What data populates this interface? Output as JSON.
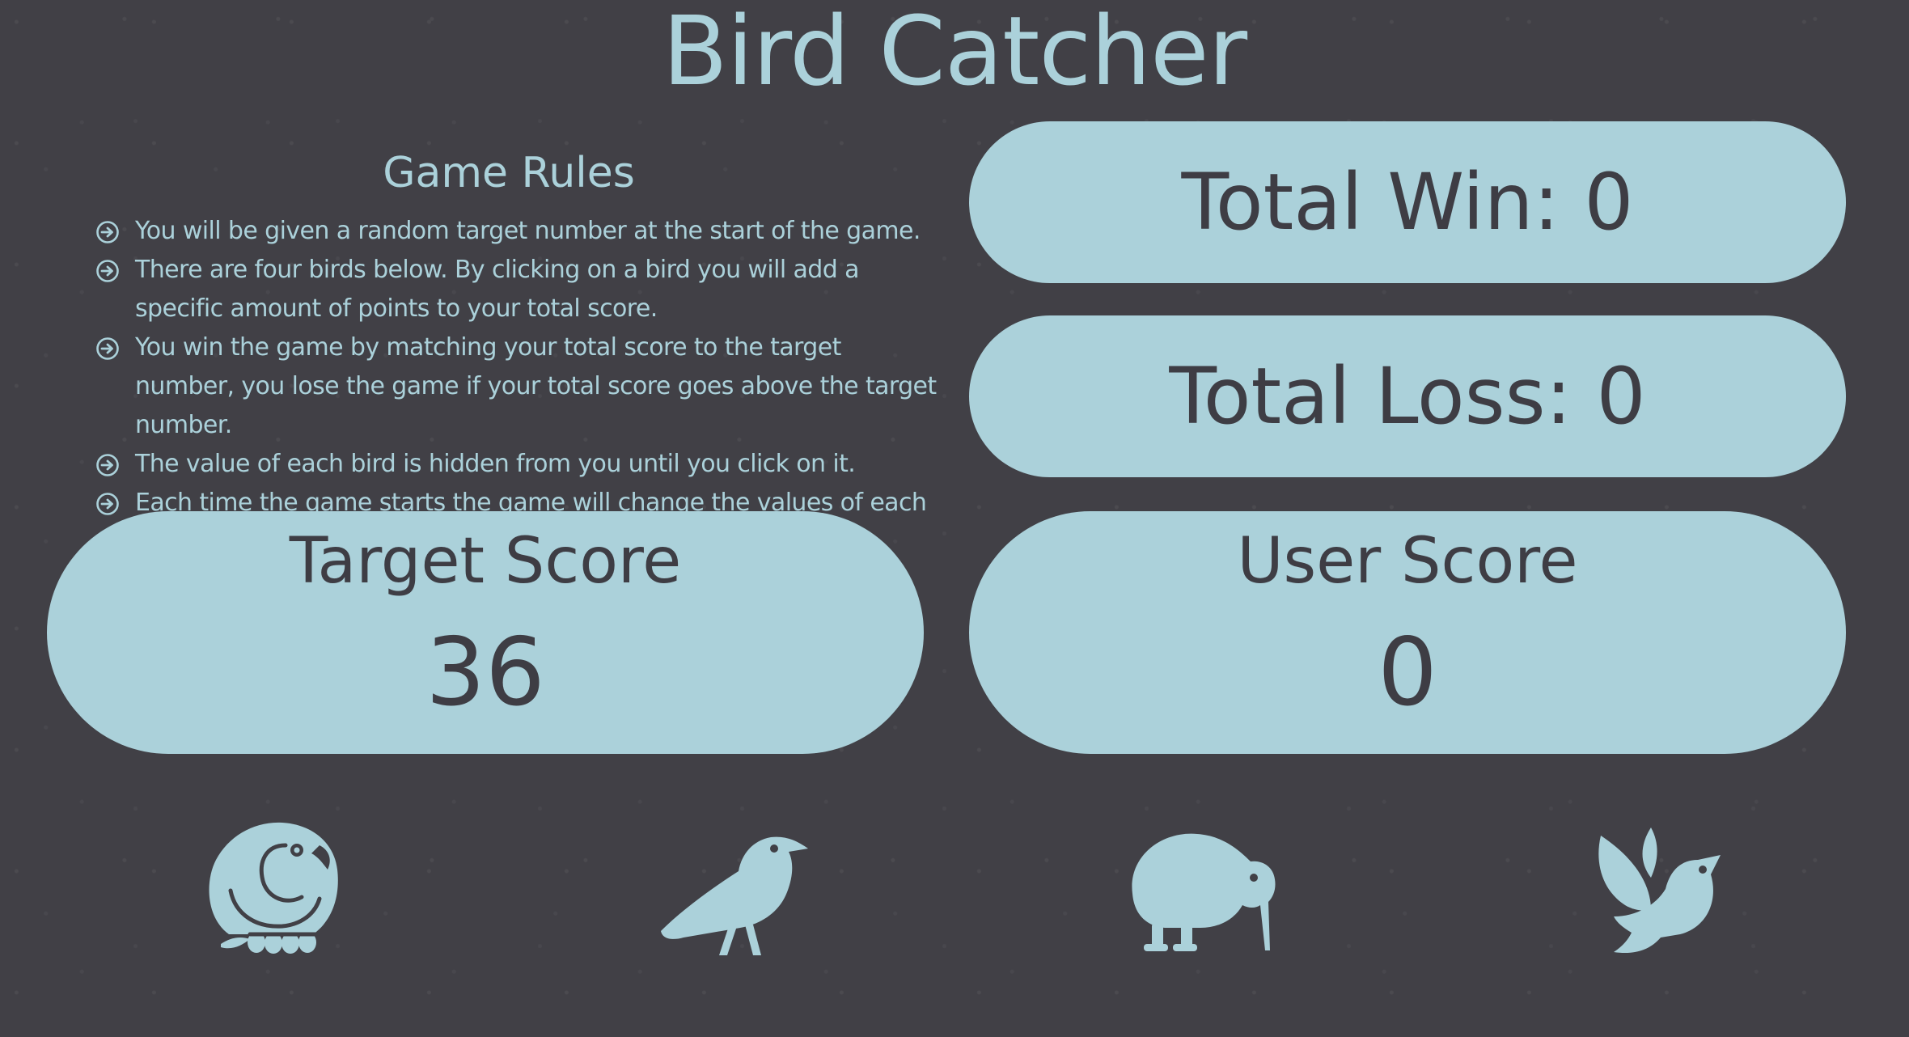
{
  "title": "Bird Catcher",
  "rules": {
    "heading": "Game Rules",
    "items": [
      "You will be given a random target number at the start of the game.",
      "There are four birds below. By clicking on a bird you will add a specific amount of points to your total score.",
      "You win the game by matching your total score to the target number, you lose the game if your total score goes above the target number.",
      "The value of each bird is hidden from you until you click on it.",
      "Each time the game starts the game will change the values of each bird."
    ],
    "bullet_icon": "arrow-circle-right-icon"
  },
  "stats": {
    "total_win": "Total Win: 0",
    "total_loss": "Total Loss: 0"
  },
  "scores": {
    "target_label": "Target Score",
    "target_value": "36",
    "user_label": "User Score",
    "user_value": "0"
  },
  "birds": [
    {
      "icon": "parrot-icon"
    },
    {
      "icon": "crow-icon"
    },
    {
      "icon": "kiwi-bird-icon"
    },
    {
      "icon": "dove-icon"
    }
  ],
  "colors": {
    "background": "#414046",
    "accent": "#abd1da",
    "dark_text": "#3e3d44"
  }
}
